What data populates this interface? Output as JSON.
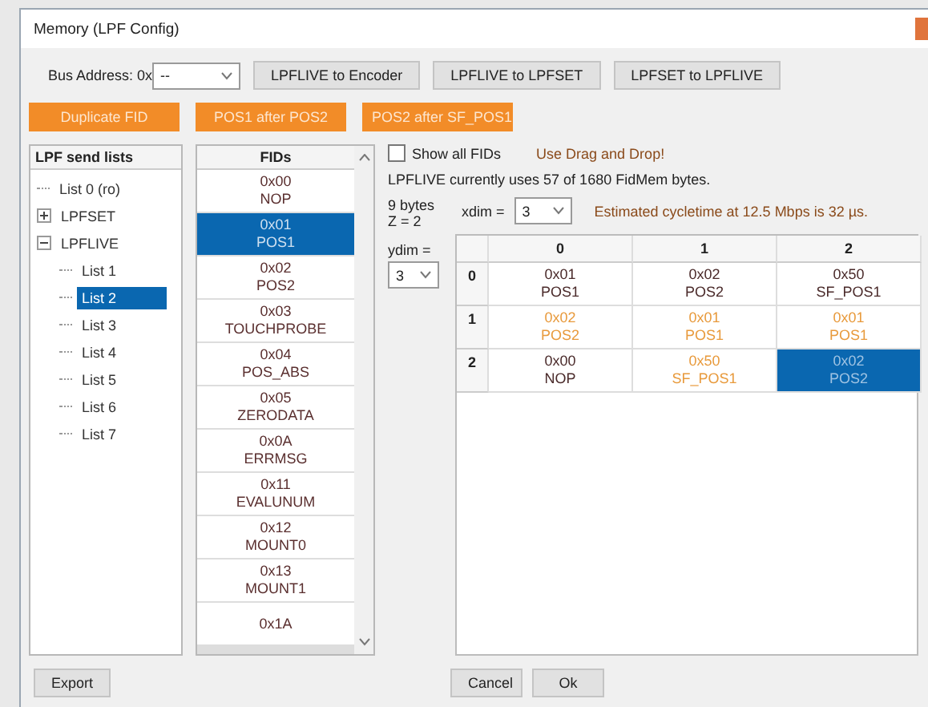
{
  "window": {
    "title": "Memory (LPF Config)"
  },
  "bus_address": {
    "label": "Bus Address: 0x",
    "value": "--"
  },
  "actions": [
    "LPFLIVE to Encoder",
    "LPFLIVE to LPFSET",
    "LPFSET to LPFLIVE"
  ],
  "orange_actions": [
    "Duplicate FID",
    "POS1 after POS2",
    "POS2 after SF_POS1"
  ],
  "send_lists": {
    "header": "LPF send lists",
    "items": [
      {
        "label": "List 0 (ro)",
        "kind": "leaf",
        "selected": false
      },
      {
        "label": "LPFSET",
        "kind": "group",
        "expanded": false,
        "selected": false
      },
      {
        "label": "LPFLIVE",
        "kind": "group",
        "expanded": true,
        "selected": false,
        "children": [
          {
            "label": "List 1",
            "kind": "leaf",
            "selected": false
          },
          {
            "label": "List 2",
            "kind": "leaf",
            "selected": true
          },
          {
            "label": "List 3",
            "kind": "leaf",
            "selected": false
          },
          {
            "label": "List 4",
            "kind": "leaf",
            "selected": false
          },
          {
            "label": "List 5",
            "kind": "leaf",
            "selected": false
          },
          {
            "label": "List 6",
            "kind": "leaf",
            "selected": false
          },
          {
            "label": "List 7",
            "kind": "leaf",
            "selected": false
          }
        ]
      }
    ]
  },
  "fids": {
    "header": "FIDs",
    "items": [
      {
        "code": "0x00",
        "name": "NOP",
        "selected": false
      },
      {
        "code": "0x01",
        "name": "POS1",
        "selected": true
      },
      {
        "code": "0x02",
        "name": "POS2",
        "selected": false
      },
      {
        "code": "0x03",
        "name": "TOUCHPROBE",
        "selected": false
      },
      {
        "code": "0x04",
        "name": "POS_ABS",
        "selected": false
      },
      {
        "code": "0x05",
        "name": "ZERODATA",
        "selected": false
      },
      {
        "code": "0x0A",
        "name": "ERRMSG",
        "selected": false
      },
      {
        "code": "0x11",
        "name": "EVALUNUM",
        "selected": false
      },
      {
        "code": "0x12",
        "name": "MOUNT0",
        "selected": false
      },
      {
        "code": "0x13",
        "name": "MOUNT1",
        "selected": false
      },
      {
        "code": "0x1A",
        "selected": false
      }
    ]
  },
  "show_all_fids": {
    "label": "Show all FIDs",
    "checked": false
  },
  "hint": "Use Drag and Drop!",
  "usage": "LPFLIVE currently uses 57 of 1680 FidMem bytes.",
  "size": "9 bytes",
  "z": "Z = 2",
  "xdim": {
    "label": "xdim =",
    "value": "3"
  },
  "ydim": {
    "label": "ydim =",
    "value": "3"
  },
  "cycletime": "Estimated cycletime at 12.5 Mbps is 32 µs.",
  "grid": {
    "columns": [
      "0",
      "1",
      "2"
    ],
    "rows": [
      {
        "label": "0",
        "cells": [
          {
            "code": "0x01",
            "name": "POS1",
            "highlight": false,
            "selected": false
          },
          {
            "code": "0x02",
            "name": "POS2",
            "highlight": false,
            "selected": false
          },
          {
            "code": "0x50",
            "name": "SF_POS1",
            "highlight": false,
            "selected": false
          }
        ]
      },
      {
        "label": "1",
        "cells": [
          {
            "code": "0x02",
            "name": "POS2",
            "highlight": true,
            "selected": false
          },
          {
            "code": "0x01",
            "name": "POS1",
            "highlight": true,
            "selected": false
          },
          {
            "code": "0x01",
            "name": "POS1",
            "highlight": true,
            "selected": false
          }
        ]
      },
      {
        "label": "2",
        "cells": [
          {
            "code": "0x00",
            "name": "NOP",
            "highlight": false,
            "selected": false
          },
          {
            "code": "0x50",
            "name": "SF_POS1",
            "highlight": true,
            "selected": false
          },
          {
            "code": "0x02",
            "name": "POS2",
            "highlight": false,
            "selected": true
          }
        ]
      }
    ]
  },
  "export": "Export",
  "footer_buttons": [
    "Cancel",
    "Ok"
  ]
}
